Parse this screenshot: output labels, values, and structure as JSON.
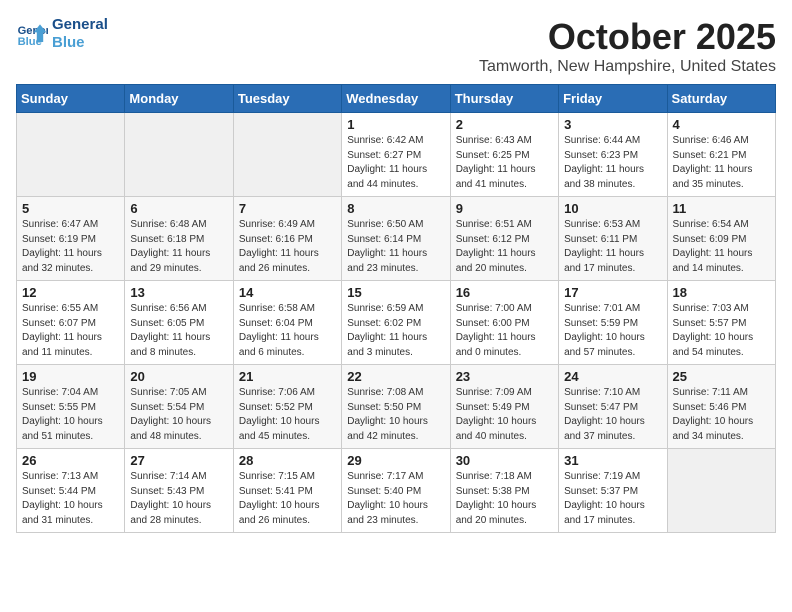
{
  "logo": {
    "line1": "General",
    "line2": "Blue"
  },
  "title": "October 2025",
  "location": "Tamworth, New Hampshire, United States",
  "days_of_week": [
    "Sunday",
    "Monday",
    "Tuesday",
    "Wednesday",
    "Thursday",
    "Friday",
    "Saturday"
  ],
  "weeks": [
    [
      {
        "day": "",
        "info": ""
      },
      {
        "day": "",
        "info": ""
      },
      {
        "day": "",
        "info": ""
      },
      {
        "day": "1",
        "info": "Sunrise: 6:42 AM\nSunset: 6:27 PM\nDaylight: 11 hours\nand 44 minutes."
      },
      {
        "day": "2",
        "info": "Sunrise: 6:43 AM\nSunset: 6:25 PM\nDaylight: 11 hours\nand 41 minutes."
      },
      {
        "day": "3",
        "info": "Sunrise: 6:44 AM\nSunset: 6:23 PM\nDaylight: 11 hours\nand 38 minutes."
      },
      {
        "day": "4",
        "info": "Sunrise: 6:46 AM\nSunset: 6:21 PM\nDaylight: 11 hours\nand 35 minutes."
      }
    ],
    [
      {
        "day": "5",
        "info": "Sunrise: 6:47 AM\nSunset: 6:19 PM\nDaylight: 11 hours\nand 32 minutes."
      },
      {
        "day": "6",
        "info": "Sunrise: 6:48 AM\nSunset: 6:18 PM\nDaylight: 11 hours\nand 29 minutes."
      },
      {
        "day": "7",
        "info": "Sunrise: 6:49 AM\nSunset: 6:16 PM\nDaylight: 11 hours\nand 26 minutes."
      },
      {
        "day": "8",
        "info": "Sunrise: 6:50 AM\nSunset: 6:14 PM\nDaylight: 11 hours\nand 23 minutes."
      },
      {
        "day": "9",
        "info": "Sunrise: 6:51 AM\nSunset: 6:12 PM\nDaylight: 11 hours\nand 20 minutes."
      },
      {
        "day": "10",
        "info": "Sunrise: 6:53 AM\nSunset: 6:11 PM\nDaylight: 11 hours\nand 17 minutes."
      },
      {
        "day": "11",
        "info": "Sunrise: 6:54 AM\nSunset: 6:09 PM\nDaylight: 11 hours\nand 14 minutes."
      }
    ],
    [
      {
        "day": "12",
        "info": "Sunrise: 6:55 AM\nSunset: 6:07 PM\nDaylight: 11 hours\nand 11 minutes."
      },
      {
        "day": "13",
        "info": "Sunrise: 6:56 AM\nSunset: 6:05 PM\nDaylight: 11 hours\nand 8 minutes."
      },
      {
        "day": "14",
        "info": "Sunrise: 6:58 AM\nSunset: 6:04 PM\nDaylight: 11 hours\nand 6 minutes."
      },
      {
        "day": "15",
        "info": "Sunrise: 6:59 AM\nSunset: 6:02 PM\nDaylight: 11 hours\nand 3 minutes."
      },
      {
        "day": "16",
        "info": "Sunrise: 7:00 AM\nSunset: 6:00 PM\nDaylight: 11 hours\nand 0 minutes."
      },
      {
        "day": "17",
        "info": "Sunrise: 7:01 AM\nSunset: 5:59 PM\nDaylight: 10 hours\nand 57 minutes."
      },
      {
        "day": "18",
        "info": "Sunrise: 7:03 AM\nSunset: 5:57 PM\nDaylight: 10 hours\nand 54 minutes."
      }
    ],
    [
      {
        "day": "19",
        "info": "Sunrise: 7:04 AM\nSunset: 5:55 PM\nDaylight: 10 hours\nand 51 minutes."
      },
      {
        "day": "20",
        "info": "Sunrise: 7:05 AM\nSunset: 5:54 PM\nDaylight: 10 hours\nand 48 minutes."
      },
      {
        "day": "21",
        "info": "Sunrise: 7:06 AM\nSunset: 5:52 PM\nDaylight: 10 hours\nand 45 minutes."
      },
      {
        "day": "22",
        "info": "Sunrise: 7:08 AM\nSunset: 5:50 PM\nDaylight: 10 hours\nand 42 minutes."
      },
      {
        "day": "23",
        "info": "Sunrise: 7:09 AM\nSunset: 5:49 PM\nDaylight: 10 hours\nand 40 minutes."
      },
      {
        "day": "24",
        "info": "Sunrise: 7:10 AM\nSunset: 5:47 PM\nDaylight: 10 hours\nand 37 minutes."
      },
      {
        "day": "25",
        "info": "Sunrise: 7:11 AM\nSunset: 5:46 PM\nDaylight: 10 hours\nand 34 minutes."
      }
    ],
    [
      {
        "day": "26",
        "info": "Sunrise: 7:13 AM\nSunset: 5:44 PM\nDaylight: 10 hours\nand 31 minutes."
      },
      {
        "day": "27",
        "info": "Sunrise: 7:14 AM\nSunset: 5:43 PM\nDaylight: 10 hours\nand 28 minutes."
      },
      {
        "day": "28",
        "info": "Sunrise: 7:15 AM\nSunset: 5:41 PM\nDaylight: 10 hours\nand 26 minutes."
      },
      {
        "day": "29",
        "info": "Sunrise: 7:17 AM\nSunset: 5:40 PM\nDaylight: 10 hours\nand 23 minutes."
      },
      {
        "day": "30",
        "info": "Sunrise: 7:18 AM\nSunset: 5:38 PM\nDaylight: 10 hours\nand 20 minutes."
      },
      {
        "day": "31",
        "info": "Sunrise: 7:19 AM\nSunset: 5:37 PM\nDaylight: 10 hours\nand 17 minutes."
      },
      {
        "day": "",
        "info": ""
      }
    ]
  ]
}
